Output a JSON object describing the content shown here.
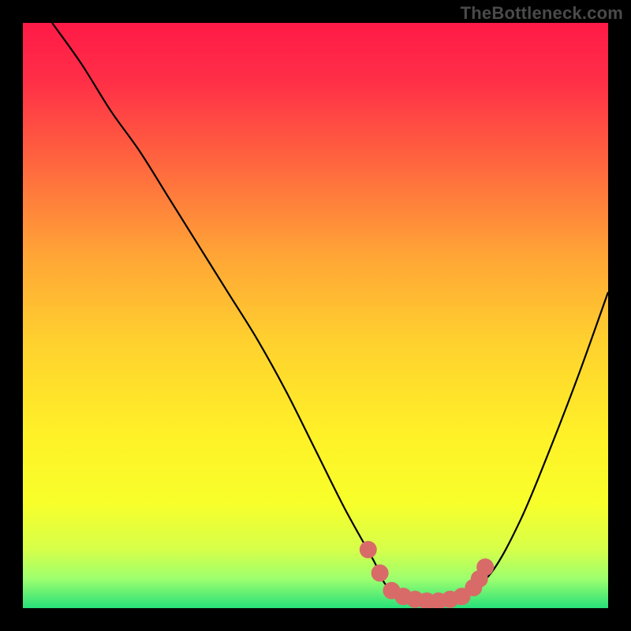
{
  "watermark": "TheBottleneck.com",
  "colors": {
    "gradient_stops": [
      {
        "offset": 0.0,
        "color": "#ff1a47"
      },
      {
        "offset": 0.1,
        "color": "#ff2f47"
      },
      {
        "offset": 0.25,
        "color": "#ff6a3e"
      },
      {
        "offset": 0.4,
        "color": "#ffa636"
      },
      {
        "offset": 0.55,
        "color": "#ffd22e"
      },
      {
        "offset": 0.7,
        "color": "#fff028"
      },
      {
        "offset": 0.82,
        "color": "#f8ff2a"
      },
      {
        "offset": 0.9,
        "color": "#d6ff4a"
      },
      {
        "offset": 0.95,
        "color": "#9dff6e"
      },
      {
        "offset": 1.0,
        "color": "#27e07a"
      }
    ],
    "curve": "#000000",
    "marker": "#d86b68"
  },
  "chart_data": {
    "type": "line",
    "title": "",
    "xlabel": "",
    "ylabel": "",
    "xlim": [
      0,
      100
    ],
    "ylim": [
      0,
      100
    ],
    "series": [
      {
        "name": "bottleneck-curve",
        "x": [
          5,
          10,
          15,
          20,
          25,
          30,
          35,
          40,
          45,
          50,
          55,
          60,
          62,
          65,
          70,
          75,
          80,
          85,
          90,
          95,
          100
        ],
        "y": [
          100,
          93,
          85,
          78,
          70,
          62,
          54,
          46,
          37,
          27,
          17,
          8,
          4,
          2,
          1,
          2,
          6,
          15,
          27,
          40,
          54
        ]
      }
    ],
    "markers": {
      "name": "optimal-region",
      "points": [
        {
          "x": 59,
          "y": 10
        },
        {
          "x": 61,
          "y": 6
        },
        {
          "x": 63,
          "y": 3
        },
        {
          "x": 65,
          "y": 2
        },
        {
          "x": 67,
          "y": 1.5
        },
        {
          "x": 69,
          "y": 1.2
        },
        {
          "x": 71,
          "y": 1.2
        },
        {
          "x": 73,
          "y": 1.5
        },
        {
          "x": 75,
          "y": 2
        },
        {
          "x": 77,
          "y": 3.5
        },
        {
          "x": 78,
          "y": 5
        },
        {
          "x": 79,
          "y": 7
        }
      ]
    }
  }
}
